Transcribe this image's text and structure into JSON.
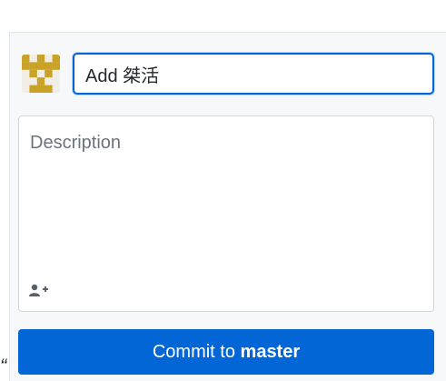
{
  "commit_form": {
    "summary_value": "Add 桀活",
    "description_placeholder": "Description",
    "commit_button": {
      "prefix": "Commit to ",
      "branch": "master"
    },
    "stray_text": "“"
  },
  "icons": {
    "avatar": "identicon-avatar",
    "coauthor": "add-coauthor-icon"
  },
  "colors": {
    "accent": "#0366d6",
    "avatar_gold": "#c9a227",
    "panel_bg": "#f6f8fa"
  }
}
